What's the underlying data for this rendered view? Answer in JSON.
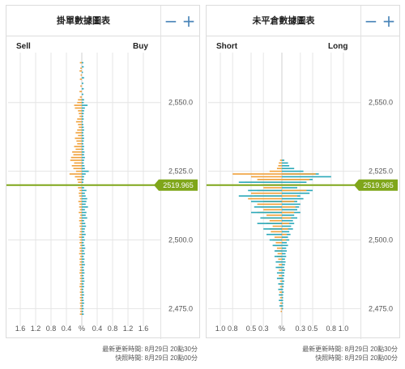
{
  "colors": {
    "sell": "#f0a038",
    "buy": "#2aa8b8",
    "price_line": "#7fa61a",
    "price_label_bg": "#7fa61a",
    "price_label_text": "#ffffff",
    "zoom_icon": "#4a84b8"
  },
  "current_price_label": "2519.965",
  "panels": [
    {
      "title": "掛單數據圖表",
      "left_label": "Sell",
      "right_label": "Buy",
      "zoom_out": "−",
      "zoom_in": "+",
      "timestamp_update": "最新更新時間: 8月29日 20點30分",
      "timestamp_snapshot": "快照時間: 8月29日 20點00分"
    },
    {
      "title": "未平倉數據圖表",
      "left_label": "Short",
      "right_label": "Long",
      "zoom_out": "−",
      "zoom_in": "+",
      "timestamp_update": "最新更新時間: 8月29日 20點30分",
      "timestamp_snapshot": "快照時間: 8月29日 20點00分"
    }
  ],
  "chart_data": [
    {
      "type": "bar",
      "orientation": "horizontal-butterfly",
      "title": "掛單數據圖表",
      "left_series": "Sell",
      "right_series": "Buy",
      "xlabel": "%",
      "x_tick_labels": [
        "1.6",
        "1.2",
        "0.8",
        "0.4",
        "%",
        "0.4",
        "0.8",
        "1.2",
        "1.6"
      ],
      "x_ticks_left": [
        1.6,
        1.2,
        0.8,
        0.4
      ],
      "x_ticks_right": [
        0.4,
        0.8,
        1.2,
        1.6
      ],
      "xlim": [
        -1.6,
        1.6
      ],
      "ylim": [
        2471,
        2567
      ],
      "y_ticks": [
        2475,
        2500,
        2525,
        2550
      ],
      "y_tick_labels": [
        "2,475.0",
        "2,500.0",
        "2,525.0",
        "2,550.0"
      ],
      "current_price": 2519.965,
      "sell": [
        [
          2564.5,
          0.05
        ],
        [
          2562.5,
          0.04
        ],
        [
          2561.5,
          0.06
        ],
        [
          2560,
          0.03
        ],
        [
          2558.5,
          0.05
        ],
        [
          2556,
          0.04
        ],
        [
          2554,
          0.06
        ],
        [
          2552,
          0.05
        ],
        [
          2551,
          0.1
        ],
        [
          2550,
          0.12
        ],
        [
          2549,
          0.2
        ],
        [
          2548,
          0.18
        ],
        [
          2547,
          0.1
        ],
        [
          2546,
          0.08
        ],
        [
          2545,
          0.06
        ],
        [
          2544,
          0.12
        ],
        [
          2543,
          0.15
        ],
        [
          2542,
          0.1
        ],
        [
          2541,
          0.08
        ],
        [
          2540,
          0.12
        ],
        [
          2539,
          0.16
        ],
        [
          2538,
          0.1
        ],
        [
          2537,
          0.18
        ],
        [
          2536,
          0.14
        ],
        [
          2535,
          0.12
        ],
        [
          2534,
          0.2
        ],
        [
          2533,
          0.16
        ],
        [
          2532,
          0.25
        ],
        [
          2531,
          0.22
        ],
        [
          2530,
          0.28
        ],
        [
          2529,
          0.3
        ],
        [
          2528,
          0.2
        ],
        [
          2527,
          0.26
        ],
        [
          2526,
          0.22
        ],
        [
          2525,
          0.15
        ],
        [
          2524,
          0.32
        ],
        [
          2523,
          0.18
        ],
        [
          2522,
          0.12
        ],
        [
          2521,
          0.1
        ],
        [
          2519,
          0.1
        ],
        [
          2518,
          0.06
        ],
        [
          2517,
          0.08
        ],
        [
          2516,
          0.07
        ],
        [
          2515,
          0.05
        ],
        [
          2514,
          0.09
        ],
        [
          2513,
          0.06
        ],
        [
          2512,
          0.07
        ],
        [
          2511,
          0.05
        ],
        [
          2510,
          0.08
        ],
        [
          2509,
          0.04
        ],
        [
          2508,
          0.06
        ],
        [
          2507,
          0.07
        ],
        [
          2506,
          0.05
        ],
        [
          2505,
          0.06
        ],
        [
          2504,
          0.04
        ],
        [
          2503,
          0.05
        ],
        [
          2502,
          0.06
        ],
        [
          2501,
          0.07
        ],
        [
          2500,
          0.05
        ],
        [
          2499,
          0.06
        ],
        [
          2498,
          0.04
        ],
        [
          2497,
          0.06
        ],
        [
          2496,
          0.05
        ],
        [
          2495,
          0.07
        ],
        [
          2494,
          0.04
        ],
        [
          2493,
          0.06
        ],
        [
          2492,
          0.05
        ],
        [
          2491,
          0.06
        ],
        [
          2490,
          0.04
        ],
        [
          2489,
          0.05
        ],
        [
          2488,
          0.06
        ],
        [
          2487,
          0.04
        ],
        [
          2486,
          0.05
        ],
        [
          2485,
          0.04
        ],
        [
          2484,
          0.05
        ],
        [
          2483,
          0.06
        ],
        [
          2482,
          0.04
        ],
        [
          2481,
          0.05
        ],
        [
          2480,
          0.04
        ],
        [
          2479,
          0.05
        ],
        [
          2478,
          0.04
        ],
        [
          2477,
          0.05
        ],
        [
          2476,
          0.04
        ],
        [
          2475,
          0.05
        ],
        [
          2474,
          0.04
        ],
        [
          2473,
          0.05
        ]
      ],
      "buy": [
        [
          2564.5,
          0.04
        ],
        [
          2563,
          0.05
        ],
        [
          2561,
          0.03
        ],
        [
          2559,
          0.06
        ],
        [
          2557,
          0.04
        ],
        [
          2555,
          0.05
        ],
        [
          2553,
          0.04
        ],
        [
          2551,
          0.06
        ],
        [
          2550,
          0.05
        ],
        [
          2549,
          0.15
        ],
        [
          2548,
          0.08
        ],
        [
          2547,
          0.06
        ],
        [
          2546,
          0.05
        ],
        [
          2545,
          0.04
        ],
        [
          2544,
          0.05
        ],
        [
          2543,
          0.03
        ],
        [
          2542,
          0.04
        ],
        [
          2541,
          0.05
        ],
        [
          2540,
          0.06
        ],
        [
          2539,
          0.04
        ],
        [
          2538,
          0.05
        ],
        [
          2537,
          0.06
        ],
        [
          2536,
          0.05
        ],
        [
          2535,
          0.04
        ],
        [
          2534,
          0.06
        ],
        [
          2533,
          0.05
        ],
        [
          2532,
          0.07
        ],
        [
          2531,
          0.06
        ],
        [
          2530,
          0.08
        ],
        [
          2529,
          0.06
        ],
        [
          2528,
          0.05
        ],
        [
          2527,
          0.07
        ],
        [
          2526,
          0.08
        ],
        [
          2525,
          0.18
        ],
        [
          2524,
          0.1
        ],
        [
          2523,
          0.06
        ],
        [
          2522,
          0.05
        ],
        [
          2521,
          0.04
        ],
        [
          2519,
          0.06
        ],
        [
          2518,
          0.12
        ],
        [
          2517,
          0.08
        ],
        [
          2516,
          0.1
        ],
        [
          2515,
          0.14
        ],
        [
          2514,
          0.12
        ],
        [
          2513,
          0.1
        ],
        [
          2512,
          0.16
        ],
        [
          2511,
          0.08
        ],
        [
          2510,
          0.12
        ],
        [
          2509,
          0.1
        ],
        [
          2508,
          0.14
        ],
        [
          2507,
          0.06
        ],
        [
          2506,
          0.09
        ],
        [
          2505,
          0.11
        ],
        [
          2504,
          0.08
        ],
        [
          2503,
          0.07
        ],
        [
          2502,
          0.1
        ],
        [
          2501,
          0.06
        ],
        [
          2500,
          0.08
        ],
        [
          2499,
          0.05
        ],
        [
          2498,
          0.07
        ],
        [
          2497,
          0.09
        ],
        [
          2496,
          0.06
        ],
        [
          2495,
          0.08
        ],
        [
          2494,
          0.05
        ],
        [
          2493,
          0.07
        ],
        [
          2492,
          0.06
        ],
        [
          2491,
          0.08
        ],
        [
          2490,
          0.05
        ],
        [
          2489,
          0.06
        ],
        [
          2488,
          0.07
        ],
        [
          2487,
          0.05
        ],
        [
          2486,
          0.06
        ],
        [
          2485,
          0.07
        ],
        [
          2484,
          0.05
        ],
        [
          2483,
          0.06
        ],
        [
          2482,
          0.04
        ],
        [
          2481,
          0.05
        ],
        [
          2480,
          0.06
        ],
        [
          2479,
          0.04
        ],
        [
          2478,
          0.05
        ],
        [
          2477,
          0.06
        ],
        [
          2476,
          0.04
        ],
        [
          2475,
          0.05
        ],
        [
          2474,
          0.04
        ],
        [
          2473,
          0.05
        ]
      ]
    },
    {
      "type": "bar",
      "orientation": "horizontal-butterfly",
      "title": "未平倉數據圖表",
      "left_series": "Short",
      "right_series": "Long",
      "xlabel": "%",
      "x_tick_labels": [
        "1.0",
        "0.8",
        "0.5",
        "0.3",
        "%",
        "0.3",
        "0.5",
        "0.8",
        "1.0"
      ],
      "x_ticks_left": [
        1.0,
        0.8,
        0.5,
        0.3
      ],
      "x_ticks_right": [
        0.3,
        0.5,
        0.8,
        1.0
      ],
      "xlim": [
        -1.0,
        1.0
      ],
      "ylim": [
        2471,
        2567
      ],
      "y_ticks": [
        2475,
        2500,
        2525,
        2550
      ],
      "y_tick_labels": [
        "2,475.0",
        "2,500.0",
        "2,525.0",
        "2,550.0"
      ],
      "current_price": 2519.965,
      "short": [
        [
          2529,
          0.03
        ],
        [
          2528,
          0.05
        ],
        [
          2527,
          0.06
        ],
        [
          2526,
          0.08
        ],
        [
          2525,
          0.2
        ],
        [
          2524,
          0.8
        ],
        [
          2523,
          0.5
        ],
        [
          2522,
          0.4
        ],
        [
          2521,
          0.6
        ],
        [
          2520,
          0.35
        ],
        [
          2519,
          0.3
        ],
        [
          2518,
          0.4
        ],
        [
          2517,
          0.5
        ],
        [
          2516,
          0.45
        ],
        [
          2515,
          0.55
        ],
        [
          2514,
          0.3
        ],
        [
          2513,
          0.4
        ],
        [
          2512,
          0.35
        ],
        [
          2511,
          0.3
        ],
        [
          2510,
          0.4
        ],
        [
          2509,
          0.25
        ],
        [
          2508,
          0.3
        ],
        [
          2507,
          0.2
        ],
        [
          2506,
          0.25
        ],
        [
          2505,
          0.15
        ],
        [
          2504,
          0.2
        ],
        [
          2503,
          0.18
        ],
        [
          2502,
          0.14
        ],
        [
          2501,
          0.12
        ],
        [
          2500,
          0.15
        ],
        [
          2499,
          0.1
        ],
        [
          2498,
          0.12
        ],
        [
          2497,
          0.08
        ],
        [
          2496,
          0.1
        ],
        [
          2495,
          0.07
        ],
        [
          2494,
          0.08
        ],
        [
          2493,
          0.06
        ],
        [
          2492,
          0.07
        ],
        [
          2491,
          0.05
        ],
        [
          2490,
          0.06
        ],
        [
          2489,
          0.05
        ],
        [
          2488,
          0.04
        ],
        [
          2487,
          0.05
        ],
        [
          2486,
          0.04
        ],
        [
          2485,
          0.03
        ],
        [
          2484,
          0.04
        ],
        [
          2483,
          0.03
        ],
        [
          2482,
          0.03
        ],
        [
          2481,
          0.04
        ],
        [
          2480,
          0.03
        ],
        [
          2479,
          0.03
        ],
        [
          2478,
          0.02
        ],
        [
          2477,
          0.03
        ],
        [
          2476,
          0.02
        ],
        [
          2475,
          0.02
        ],
        [
          2474,
          0.02
        ]
      ],
      "short_from_long_color": [
        [
          2521,
          0.7
        ],
        [
          2520,
          0.3
        ],
        [
          2518,
          0.55
        ],
        [
          2516,
          0.7
        ],
        [
          2514,
          0.5
        ],
        [
          2512,
          0.45
        ],
        [
          2510,
          0.5
        ],
        [
          2508,
          0.35
        ],
        [
          2506,
          0.4
        ],
        [
          2504,
          0.3
        ],
        [
          2502,
          0.25
        ],
        [
          2500,
          0.2
        ],
        [
          2498,
          0.15
        ],
        [
          2496,
          0.12
        ],
        [
          2494,
          0.12
        ],
        [
          2492,
          0.1
        ],
        [
          2490,
          0.1
        ],
        [
          2488,
          0.08
        ],
        [
          2486,
          0.08
        ],
        [
          2484,
          0.06
        ],
        [
          2482,
          0.06
        ],
        [
          2480,
          0.05
        ],
        [
          2478,
          0.05
        ],
        [
          2476,
          0.04
        ]
      ],
      "long": [
        [
          2529,
          0.04
        ],
        [
          2528,
          0.1
        ],
        [
          2527,
          0.12
        ],
        [
          2526,
          0.2
        ],
        [
          2525,
          0.35
        ],
        [
          2524,
          0.6
        ],
        [
          2523,
          0.8
        ],
        [
          2522,
          0.5
        ],
        [
          2521,
          0.4
        ],
        [
          2520,
          0.3
        ],
        [
          2519,
          0.25
        ],
        [
          2518,
          0.5
        ],
        [
          2517,
          0.45
        ],
        [
          2516,
          0.3
        ],
        [
          2515,
          0.35
        ],
        [
          2514,
          0.25
        ],
        [
          2513,
          0.3
        ],
        [
          2512,
          0.28
        ],
        [
          2511,
          0.25
        ],
        [
          2510,
          0.3
        ],
        [
          2509,
          0.2
        ],
        [
          2508,
          0.25
        ],
        [
          2507,
          0.18
        ],
        [
          2506,
          0.2
        ],
        [
          2505,
          0.15
        ],
        [
          2504,
          0.18
        ],
        [
          2503,
          0.12
        ],
        [
          2502,
          0.14
        ],
        [
          2501,
          0.1
        ],
        [
          2500,
          0.12
        ],
        [
          2499,
          0.08
        ],
        [
          2498,
          0.1
        ],
        [
          2497,
          0.07
        ],
        [
          2496,
          0.08
        ],
        [
          2495,
          0.06
        ],
        [
          2494,
          0.07
        ],
        [
          2493,
          0.05
        ],
        [
          2492,
          0.06
        ],
        [
          2491,
          0.05
        ],
        [
          2490,
          0.04
        ],
        [
          2489,
          0.05
        ],
        [
          2488,
          0.04
        ],
        [
          2487,
          0.04
        ],
        [
          2486,
          0.03
        ],
        [
          2485,
          0.04
        ],
        [
          2484,
          0.03
        ],
        [
          2483,
          0.03
        ],
        [
          2482,
          0.02
        ],
        [
          2481,
          0.03
        ],
        [
          2480,
          0.02
        ],
        [
          2479,
          0.02
        ],
        [
          2478,
          0.02
        ],
        [
          2477,
          0.02
        ],
        [
          2476,
          0.02
        ],
        [
          2475,
          0.02
        ]
      ],
      "long_from_short_color": [
        [
          2524,
          0.55
        ],
        [
          2522,
          0.45
        ],
        [
          2520,
          0.3
        ],
        [
          2518,
          0.4
        ],
        [
          2516,
          0.25
        ],
        [
          2514,
          0.2
        ],
        [
          2512,
          0.22
        ],
        [
          2510,
          0.2
        ],
        [
          2508,
          0.15
        ],
        [
          2506,
          0.12
        ],
        [
          2504,
          0.1
        ],
        [
          2502,
          0.08
        ],
        [
          2500,
          0.07
        ]
      ]
    }
  ]
}
